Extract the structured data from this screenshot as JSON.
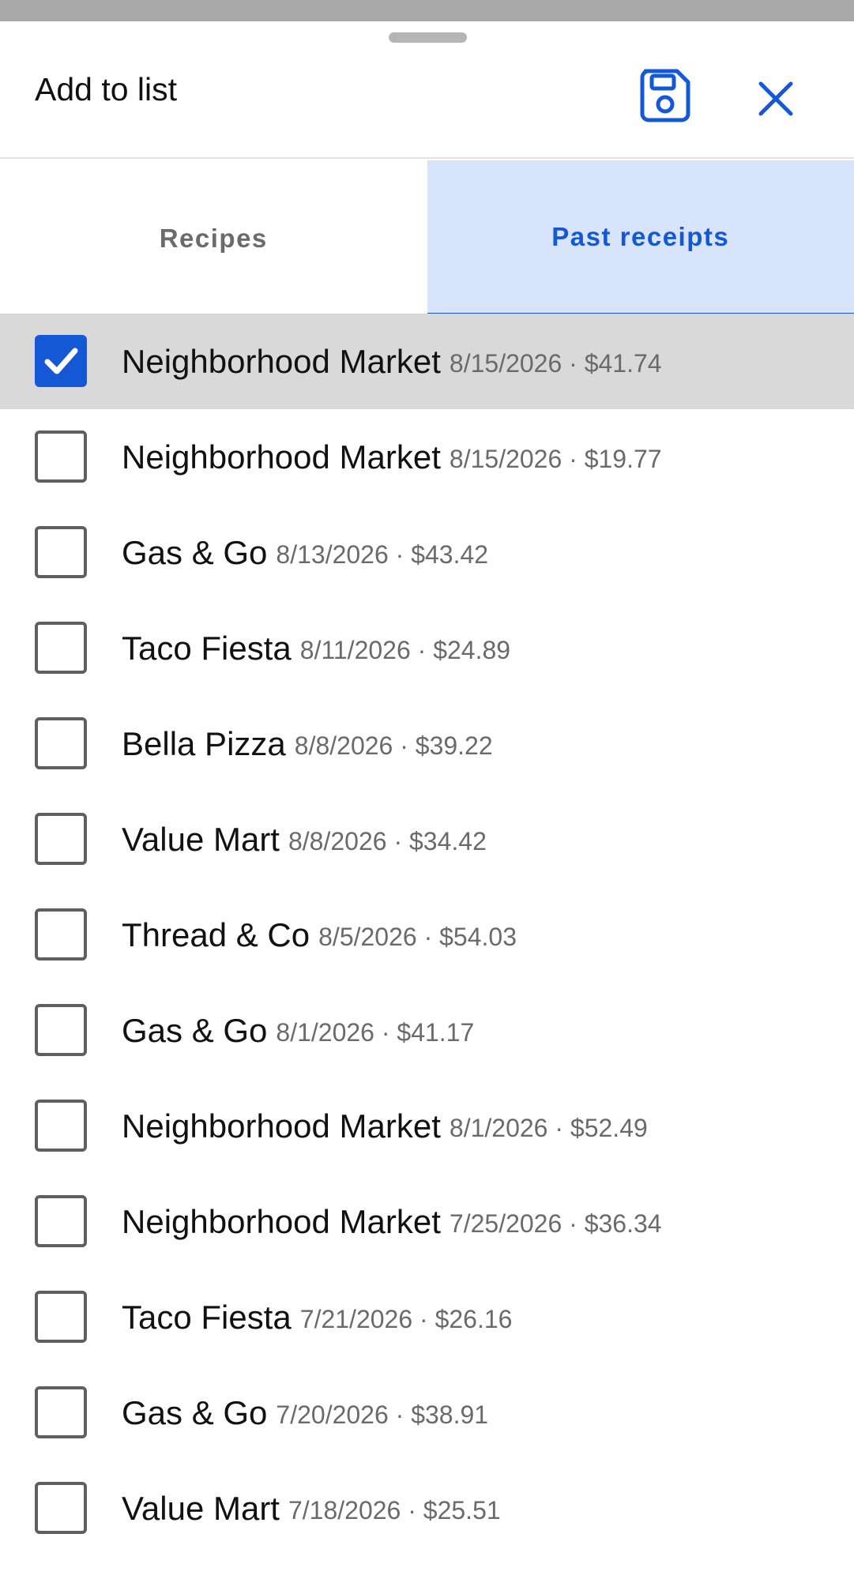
{
  "sheet": {
    "title": "Add to list",
    "save_icon": "save-icon",
    "close_icon": "close-icon",
    "accent_color": "#1558d6"
  },
  "tabs": [
    {
      "label": "Recipes",
      "active": false
    },
    {
      "label": "Past receipts",
      "active": true
    }
  ],
  "receipts": [
    {
      "store": "Neighborhood Market",
      "meta": "8/15/2026 · $41.74",
      "checked": true
    },
    {
      "store": "Neighborhood Market",
      "meta": "8/15/2026 · $19.77",
      "checked": false
    },
    {
      "store": "Gas & Go",
      "meta": "8/13/2026 · $43.42",
      "checked": false
    },
    {
      "store": "Taco Fiesta",
      "meta": "8/11/2026 · $24.89",
      "checked": false
    },
    {
      "store": "Bella Pizza",
      "meta": "8/8/2026 · $39.22",
      "checked": false
    },
    {
      "store": "Value Mart",
      "meta": "8/8/2026 · $34.42",
      "checked": false
    },
    {
      "store": "Thread & Co",
      "meta": "8/5/2026 · $54.03",
      "checked": false
    },
    {
      "store": "Gas & Go",
      "meta": "8/1/2026 · $41.17",
      "checked": false
    },
    {
      "store": "Neighborhood Market",
      "meta": "8/1/2026 · $52.49",
      "checked": false
    },
    {
      "store": "Neighborhood Market",
      "meta": "7/25/2026 · $36.34",
      "checked": false
    },
    {
      "store": "Taco Fiesta",
      "meta": "7/21/2026 · $26.16",
      "checked": false
    },
    {
      "store": "Gas & Go",
      "meta": "7/20/2026 · $38.91",
      "checked": false
    },
    {
      "store": "Value Mart",
      "meta": "7/18/2026 · $25.51",
      "checked": false
    }
  ]
}
